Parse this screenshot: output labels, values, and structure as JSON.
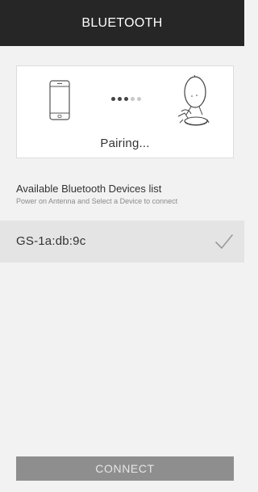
{
  "header": {
    "title": "BLUETOOTH"
  },
  "pairing": {
    "status_text": "Pairing...",
    "left_icon": "smartphone-icon",
    "right_icon": "satellite-antenna-icon",
    "progress_dots": {
      "active": 3,
      "total": 5
    }
  },
  "devices": {
    "title": "Available Bluetooth Devices list",
    "subtitle": "Power on Antenna and Select a Device to connect",
    "items": [
      {
        "name": "GS-1a:db:9c",
        "selected": true,
        "icon": "checkmark-icon"
      }
    ]
  },
  "footer": {
    "connect_label": "CONNECT"
  },
  "colors": {
    "header_bg": "#262626",
    "page_bg": "#f2f2f2",
    "selected_row_bg": "#e4e4e4",
    "button_bg": "#8e8e8e",
    "dot_active": "#444444",
    "dot_inactive": "#c8c8c8"
  }
}
